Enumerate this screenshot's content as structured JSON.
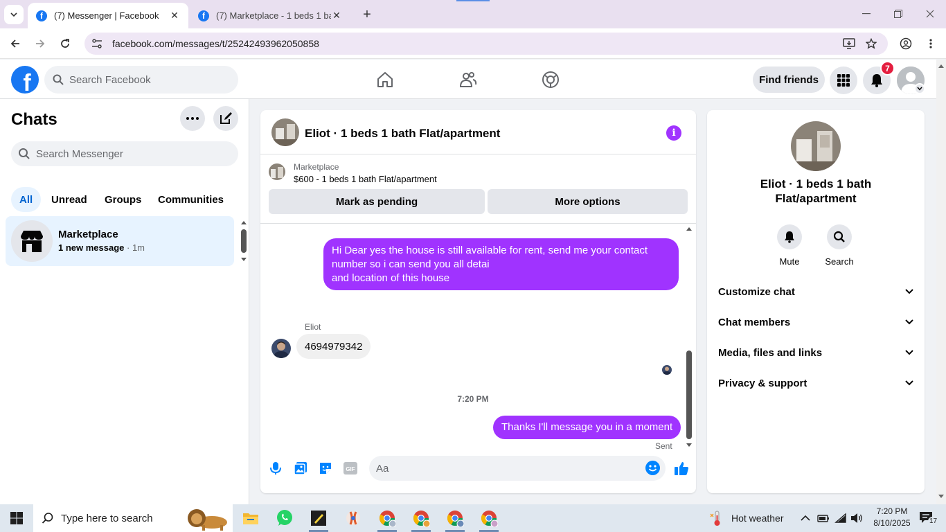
{
  "browser": {
    "tabs": [
      {
        "title": "(7) Messenger | Facebook",
        "active": true
      },
      {
        "title": "(7) Marketplace - 1 beds 1 bath Flat/apartment",
        "active": false
      }
    ],
    "url": "facebook.com/messages/t/25242493962050858"
  },
  "facebook": {
    "search_placeholder": "Search Facebook",
    "find_friends_label": "Find friends",
    "notification_count": "7"
  },
  "sidebar": {
    "title": "Chats",
    "search_placeholder": "Search Messenger",
    "filters": [
      "All",
      "Unread",
      "Groups",
      "Communities"
    ],
    "active_filter": "All",
    "chats": [
      {
        "name": "Marketplace",
        "preview": "1 new message",
        "time": "1m",
        "unread": true
      }
    ]
  },
  "conversation": {
    "title": "Eliot · 1 beds 1 bath Flat/apartment",
    "marketplace": {
      "label": "Marketplace",
      "listing": "$600 - 1 beds 1 bath Flat/apartment",
      "mark_pending_label": "Mark as pending",
      "more_options_label": "More options"
    },
    "messages": [
      {
        "direction": "out",
        "lines": [
          "Hi Dear yes the house is still available for rent, send me your contact",
          "number so i can send you all detai",
          "and location of this house"
        ]
      },
      {
        "direction": "in",
        "sender": "Eliot",
        "text": "4694979342"
      },
      {
        "timestamp": "7:20 PM"
      },
      {
        "direction": "out",
        "text": "Thanks I'll message you in a moment",
        "status": "Sent"
      }
    ],
    "composer_placeholder": "Aa"
  },
  "info_panel": {
    "name": "Eliot · 1 beds 1 bath Flat/apartment",
    "actions": [
      {
        "label": "Mute",
        "icon": "bell-icon"
      },
      {
        "label": "Search",
        "icon": "search-icon"
      }
    ],
    "sections": [
      "Customize chat",
      "Chat members",
      "Media, files and links",
      "Privacy & support"
    ]
  },
  "taskbar": {
    "search_placeholder": "Type here to search",
    "weather": "Hot weather",
    "time": "7:20 PM",
    "date": "8/10/2025",
    "notification_count": "17"
  },
  "colors": {
    "messenger_purple": "#a033ff",
    "facebook_blue": "#1877f2",
    "messenger_blue": "#0084ff",
    "badge_red": "#e41e3f"
  }
}
